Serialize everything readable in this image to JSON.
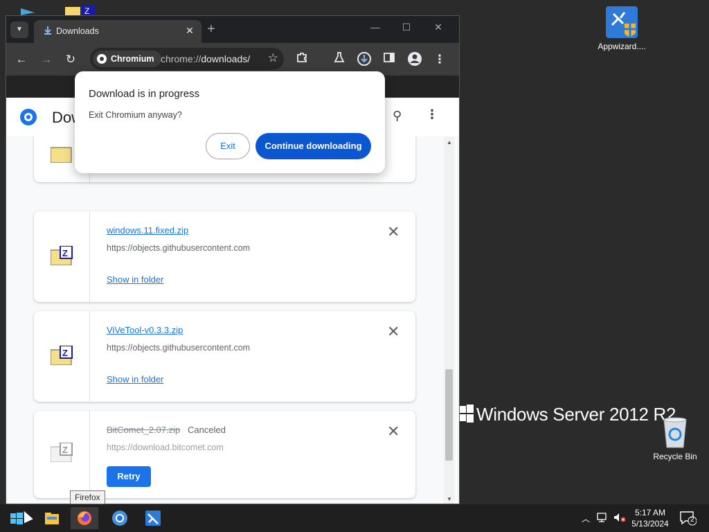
{
  "desktop": {
    "icons": [
      {
        "label": "Appwizard...."
      },
      {
        "label": "Recycle Bin"
      }
    ],
    "watermark": "Windows Server 2012 R2"
  },
  "browser": {
    "tab": {
      "title": "Downloads"
    },
    "omnibox": {
      "chip": "Chromium",
      "url_scheme": "chrome://",
      "url_path": "downloads/"
    },
    "page_title": "Dow"
  },
  "dialog": {
    "title": "Download is in progress",
    "message": "Exit Chromium anyway?",
    "exit_label": "Exit",
    "continue_label": "Continue downloading"
  },
  "downloads": [
    {
      "name": "windows.11.fixed.zip",
      "source": "https://objects.githubusercontent.com",
      "action": "Show in folder"
    },
    {
      "name": "ViVeTool-v0.3.3.zip",
      "source": "https://objects.githubusercontent.com",
      "action": "Show in folder"
    },
    {
      "name": "BitComet_2.07.zip",
      "status": "Canceled",
      "source": "https://download.bitcomet.com",
      "action": "Retry"
    }
  ],
  "tooltip": "Firefox",
  "taskbar": {
    "clock_time": "5:17 AM",
    "clock_date": "5/13/2024",
    "notification_count": "2"
  },
  "colors": {
    "accent": "#1a73e8",
    "dialog_primary": "#0b57d0",
    "taskbar": "#1f1f1f"
  }
}
